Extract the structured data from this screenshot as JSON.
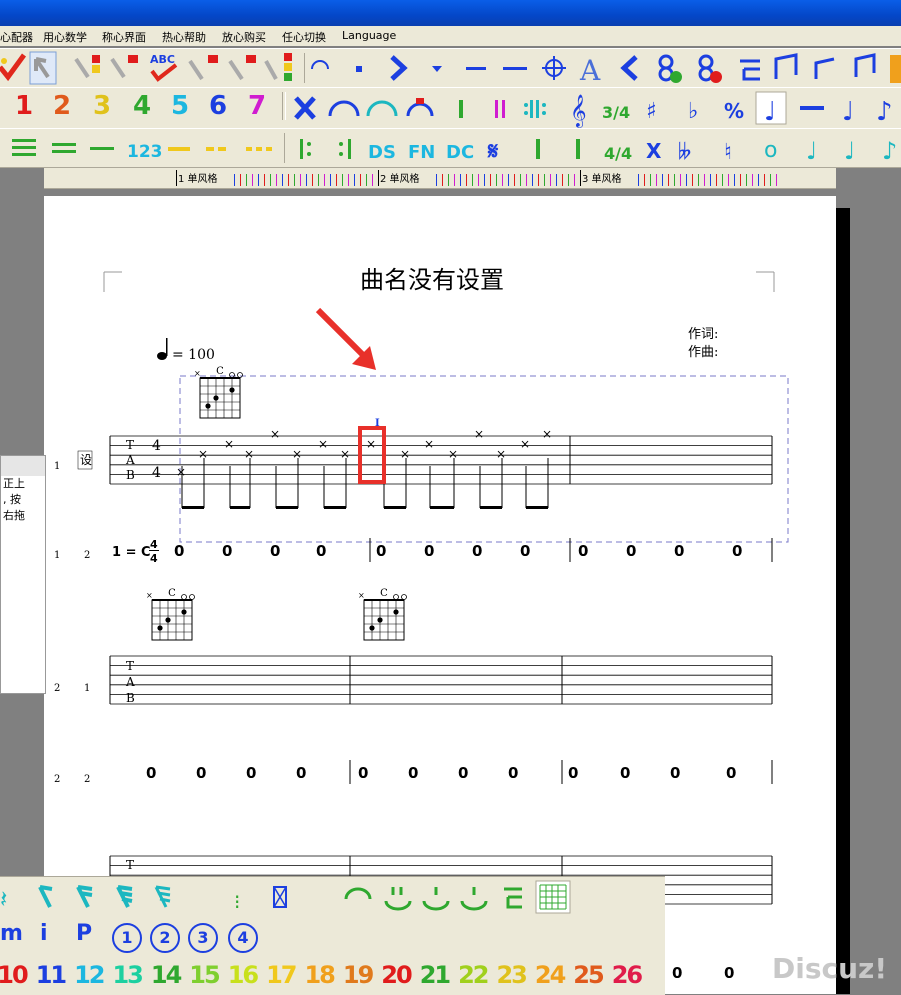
{
  "menu": {
    "items": [
      "心配器",
      "用心数学",
      "称心界面",
      "热心帮助",
      "放心购买",
      "任心切换",
      "Language"
    ]
  },
  "toolbar1": {
    "abc_label": "ABC"
  },
  "toolbar2": {
    "numbers": [
      "1",
      "2",
      "3",
      "4",
      "5",
      "6",
      "7"
    ],
    "number_colors": [
      "#e01c1c",
      "#e05a1c",
      "#e0c21c",
      "#2fa82f",
      "#1cb7e0",
      "#1c3fe0",
      "#d01cd0"
    ],
    "time_sig": "3/4",
    "percent": "%"
  },
  "toolbar3": {
    "label_123": "123",
    "ds": "DS",
    "fn": "FN",
    "dc": "DC",
    "time_sig": "4/4",
    "x": "X"
  },
  "ruler": {
    "measures": [
      "1 单风格",
      "2 单风格",
      "3 单风格"
    ]
  },
  "score": {
    "title": "曲名没有设置",
    "lyricist_label": "作词:",
    "composer_label": "作曲:",
    "tempo": "= 100",
    "chord_name": "C",
    "key_label": "1 = C",
    "time_top": "4",
    "time_bottom": "4",
    "tab_letters": [
      "T",
      "A",
      "B"
    ],
    "tab_time_top": "4",
    "tab_time_bottom": "4",
    "track_label": "设",
    "row_numbers": {
      "r1a": "1",
      "r1b": "1",
      "r1c": "2",
      "r2a": "2",
      "r2b": "1",
      "r3a": "2",
      "r3b": "2"
    },
    "cursor_label": "I",
    "zeros": "0",
    "measure_zeros": [
      "0",
      "0",
      "0",
      "0"
    ]
  },
  "left_panel": {
    "lines": [
      "正上",
      ", 按",
      "右拖"
    ]
  },
  "bottom_panel": {
    "row2": [
      "m",
      "i",
      "P"
    ],
    "circled": [
      "1",
      "2",
      "3",
      "4"
    ],
    "numbers": [
      "10",
      "11",
      "12",
      "13",
      "14",
      "15",
      "16",
      "17",
      "18",
      "19",
      "20",
      "21",
      "22",
      "23",
      "24",
      "25",
      "26"
    ],
    "number_colors": [
      "#e01c1c",
      "#1c3fe0",
      "#1cb7e0",
      "#1cd0a0",
      "#2fa82f",
      "#7fcf2f",
      "#c8e01c",
      "#f0c81c",
      "#f0a01c",
      "#e07a1c",
      "#e01c1c",
      "#2fa82f",
      "#a0d01c",
      "#e0c21c",
      "#f0a01c",
      "#e05a1c",
      "#e01c4a"
    ]
  },
  "bottom_right_zeros": [
    "0",
    "0"
  ],
  "watermark": "Discuz!"
}
